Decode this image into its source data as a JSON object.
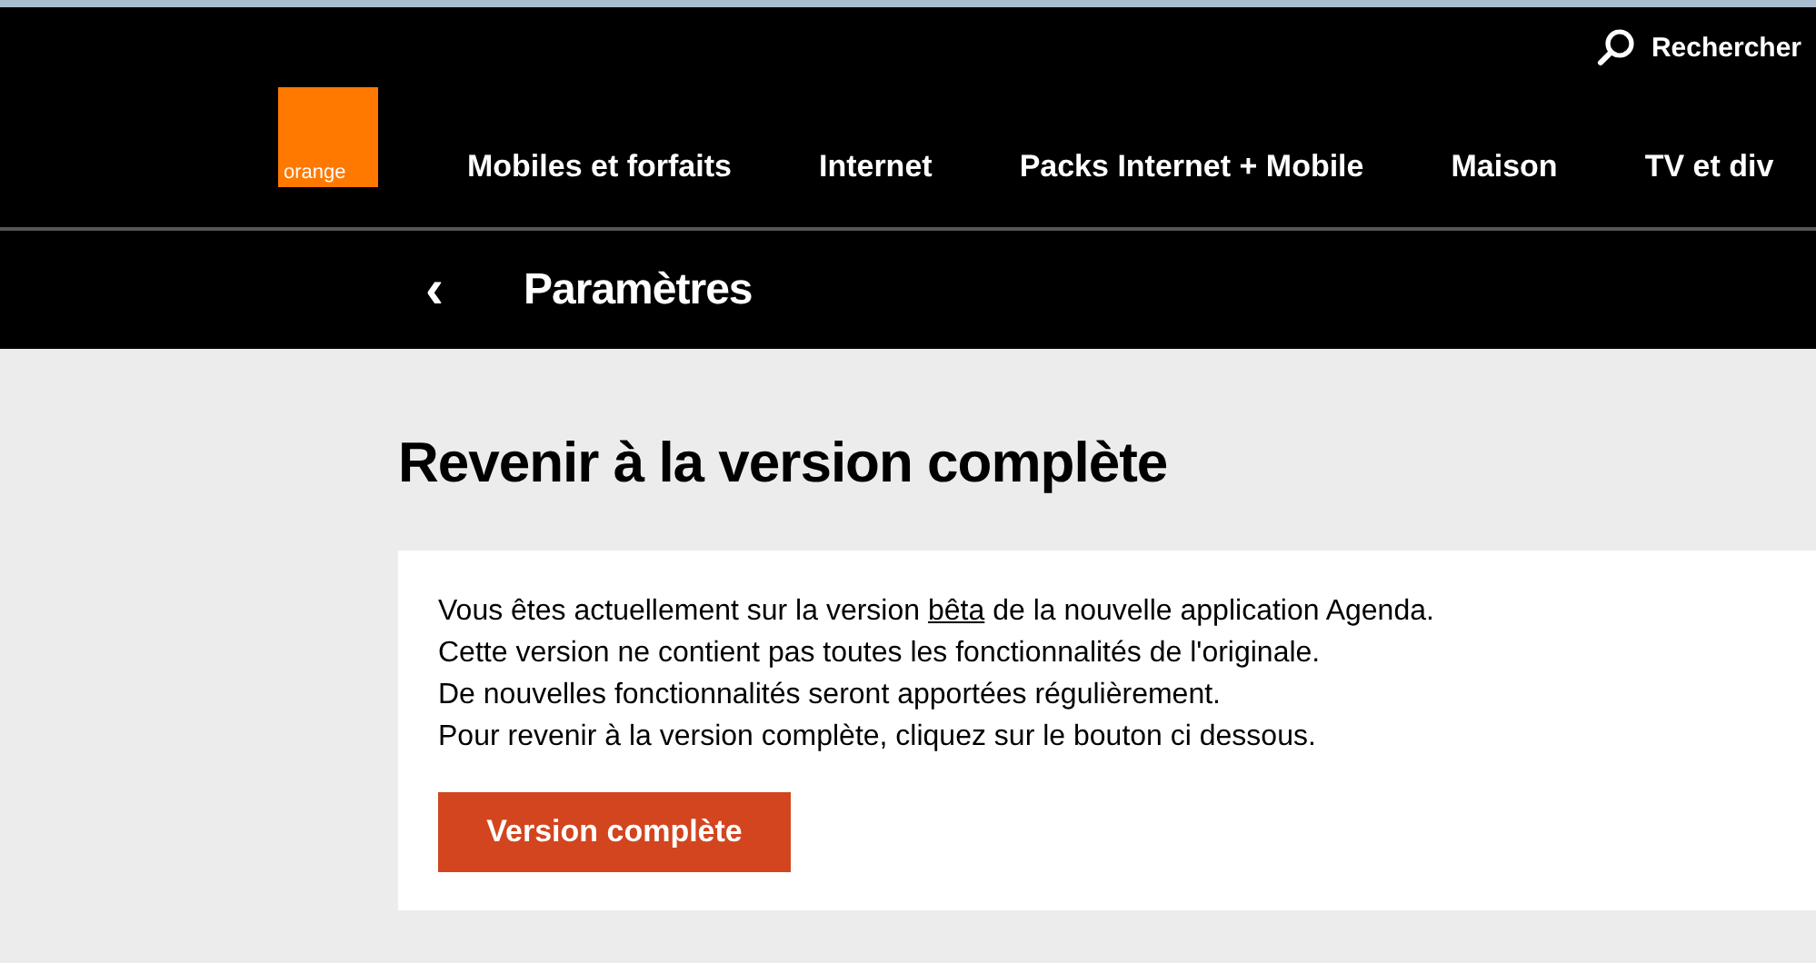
{
  "header": {
    "logo": "orange",
    "search": "Rechercher",
    "nav": [
      "Mobiles et forfaits",
      "Internet",
      "Packs Internet + Mobile",
      "Maison",
      "TV et div"
    ]
  },
  "subheader": {
    "back": "‹",
    "title": "Paramètres"
  },
  "page": {
    "heading": "Revenir à la version complète",
    "intro": {
      "before": "Vous êtes actuellement sur la version ",
      "link": "bêta",
      "after": " de la nouvelle application Agenda."
    },
    "lines": [
      "Cette version ne contient pas toutes les fonctionnalités de l'originale.",
      "De nouvelles fonctionnalités seront apportées régulièrement.",
      "Pour revenir à la version complète, cliquez sur le bouton ci dessous."
    ],
    "button": "Version complète"
  }
}
